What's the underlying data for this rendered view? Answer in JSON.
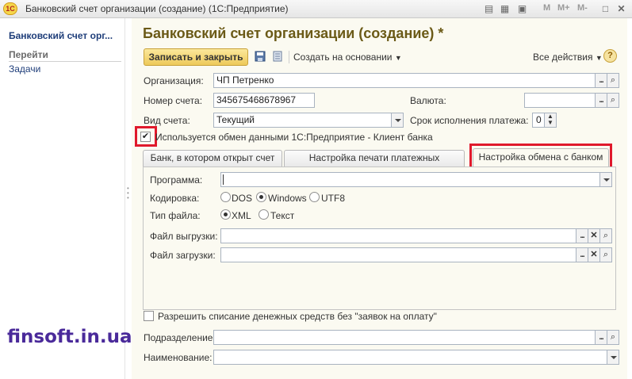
{
  "window": {
    "logo_text": "1С",
    "title": "Банковский счет организации (создание)  (1С:Предприятие)",
    "memory_buttons": [
      "M",
      "M+",
      "M-"
    ]
  },
  "left_panel": {
    "title": "Банковский счет орг...",
    "section": "Перейти",
    "links": [
      "Задачи"
    ]
  },
  "watermark": "finsoft.in.ua",
  "form": {
    "title": "Банковский счет организации (создание) *",
    "toolbar": {
      "save_close": "Записать и закрыть",
      "create_based": "Создать на основании",
      "all_actions": "Все действия",
      "help": "?"
    },
    "fields": {
      "organization_label": "Организация:",
      "organization_value": "ЧП Петренко",
      "account_number_label": "Номер счета:",
      "account_number_value": "345675468678967",
      "currency_label": "Валюта:",
      "currency_value": "",
      "account_type_label": "Вид счета:",
      "account_type_value": "Текущий",
      "payment_term_label": "Срок исполнения платежа:",
      "payment_term_value": "0",
      "exchange_checkbox_label": "Используется обмен данными 1С:Предприятие - Клиент банка"
    },
    "tabs": [
      "Банк, в котором открыт счет",
      "Настройка печати платежных поручений",
      "Настройка обмена с банком"
    ],
    "tab_panel": {
      "program_label": "Программа:",
      "program_value": "",
      "encoding_label": "Кодировка:",
      "encoding_options": [
        "DOS",
        "Windows",
        "UTF8"
      ],
      "encoding_selected": "Windows",
      "filetype_label": "Тип файла:",
      "filetype_options": [
        "XML",
        "Текст"
      ],
      "filetype_selected": "XML",
      "export_label": "Файл выгрузки:",
      "export_value": "",
      "import_label": "Файл загрузки:",
      "import_value": ""
    },
    "allow_debit_label": "Разрешить списание денежных средств без \"заявок на оплату\"",
    "division_label": "Подразделение:",
    "division_value": "",
    "name_label": "Наименование:",
    "name_value": ""
  },
  "colors": {
    "highlight": "#e0192c",
    "form_title": "#6b5a17",
    "watermark": "#4a2a9a",
    "primary_button": "#edc95a"
  }
}
